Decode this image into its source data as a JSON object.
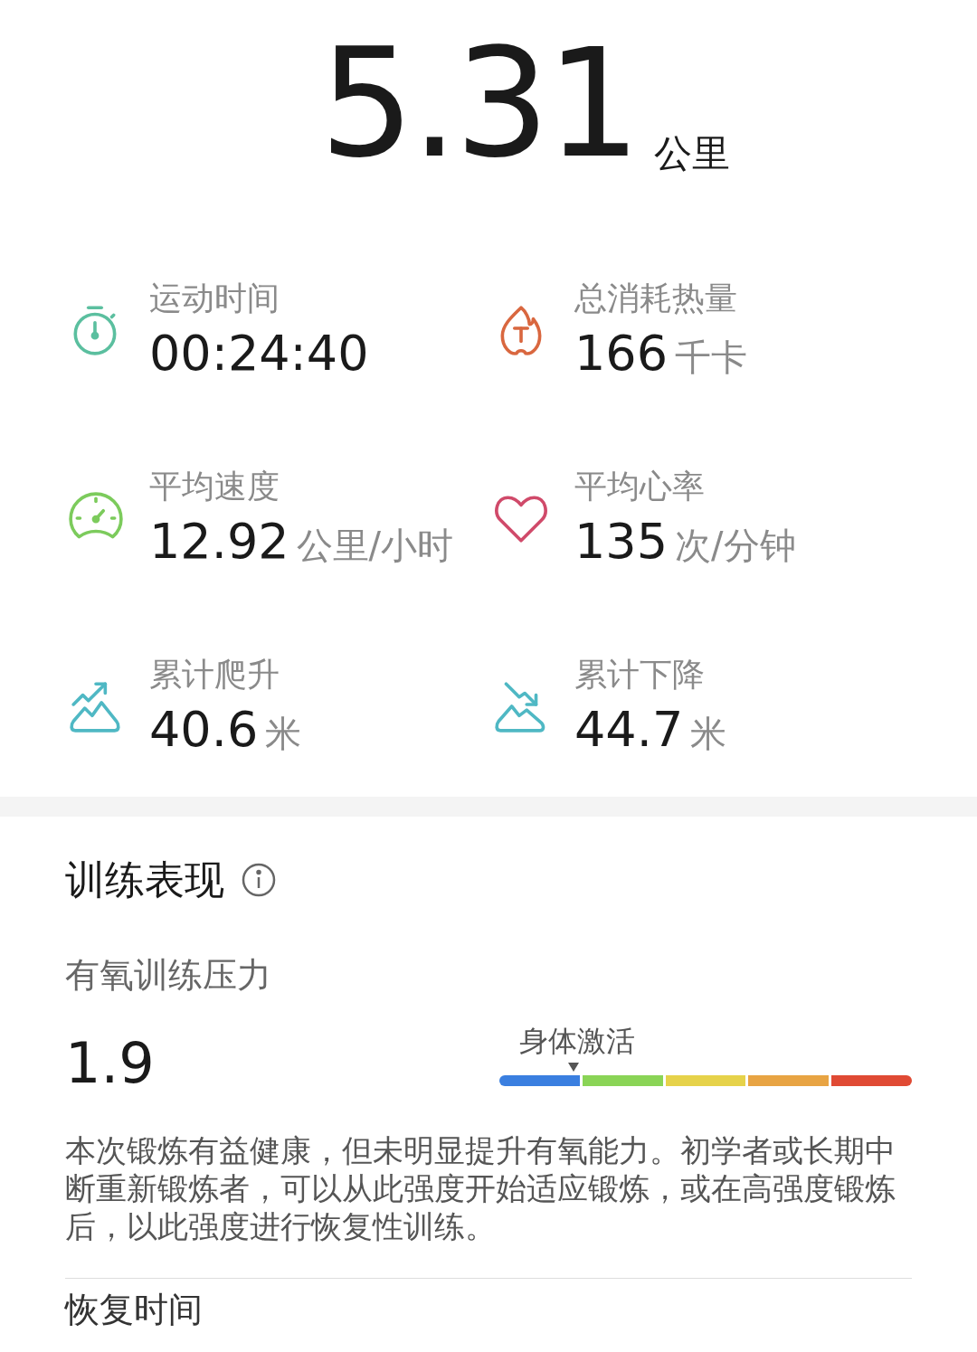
{
  "distance": {
    "value": "5.31",
    "unit": "公里"
  },
  "stats": [
    {
      "kind": "stopwatch",
      "color": "#5bbf9f",
      "label": "运动时间",
      "value": "00:24:40"
    },
    {
      "kind": "flame",
      "color": "#d9673f",
      "label": "总消耗热量",
      "value": "166",
      "unit": "千卡"
    },
    {
      "kind": "speedometer",
      "color": "#7ccb5c",
      "label": "平均速度",
      "value": "12.92",
      "unit": "公里/小时"
    },
    {
      "kind": "heart",
      "color": "#d04a6a",
      "label": "平均心率",
      "value": "135",
      "unit": "次/分钟"
    },
    {
      "kind": "ascent",
      "color": "#4fb8c4",
      "label": "累计爬升",
      "value": "40.6",
      "unit": "米"
    },
    {
      "kind": "descent",
      "color": "#4fb8c4",
      "label": "累计下降",
      "value": "44.7",
      "unit": "米"
    }
  ],
  "training": {
    "title": "训练表现",
    "metric": "有氧训练压力",
    "score": "1.9",
    "gauge": {
      "label": "身体激活",
      "segments": [
        {
          "color": "#3a7fe0"
        },
        {
          "color": "#8ad456"
        },
        {
          "color": "#e6d24a"
        },
        {
          "color": "#e8a443"
        },
        {
          "color": "#e04a34"
        }
      ]
    },
    "description": "本次锻炼有益健康，但未明显提升有氧能力。初学者或长期中断重新锻炼者，可以从此强度开始适应锻炼，或在高强度锻炼后，以此强度进行恢复性训练。"
  },
  "next_section": {
    "title": "恢复时间"
  }
}
